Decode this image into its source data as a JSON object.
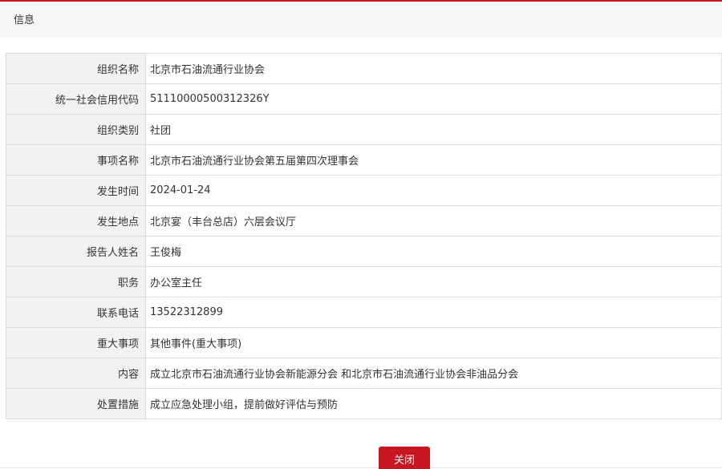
{
  "dialog": {
    "title": "信息",
    "close_label": "关闭"
  },
  "rows": [
    {
      "label": "组织名称",
      "value": "北京市石油流通行业协会"
    },
    {
      "label": "统一社会信用代码",
      "value": "51110000500312326Y"
    },
    {
      "label": "组织类别",
      "value": "社团"
    },
    {
      "label": "事项名称",
      "value": "北京市石油流通行业协会第五届第四次理事会"
    },
    {
      "label": "发生时间",
      "value": "2024-01-24"
    },
    {
      "label": "发生地点",
      "value": "北京宴（丰台总店）六层会议厅"
    },
    {
      "label": "报告人姓名",
      "value": "王俊梅"
    },
    {
      "label": "职务",
      "value": "办公室主任"
    },
    {
      "label": "联系电话",
      "value": "13522312899"
    },
    {
      "label": "重大事项",
      "value": "其他事件(重大事项)"
    },
    {
      "label": "内容",
      "value": "成立北京市石油流通行业协会新能源分会 和北京市石油流通行业协会非油品分会"
    },
    {
      "label": "处置措施",
      "value": "成立应急处理小组，提前做好评估与预防"
    }
  ],
  "colors": {
    "accent": "#c81623",
    "label_background": "#f2f2f2",
    "header_background": "#f7f7f7",
    "border": "#dcdcdc"
  }
}
